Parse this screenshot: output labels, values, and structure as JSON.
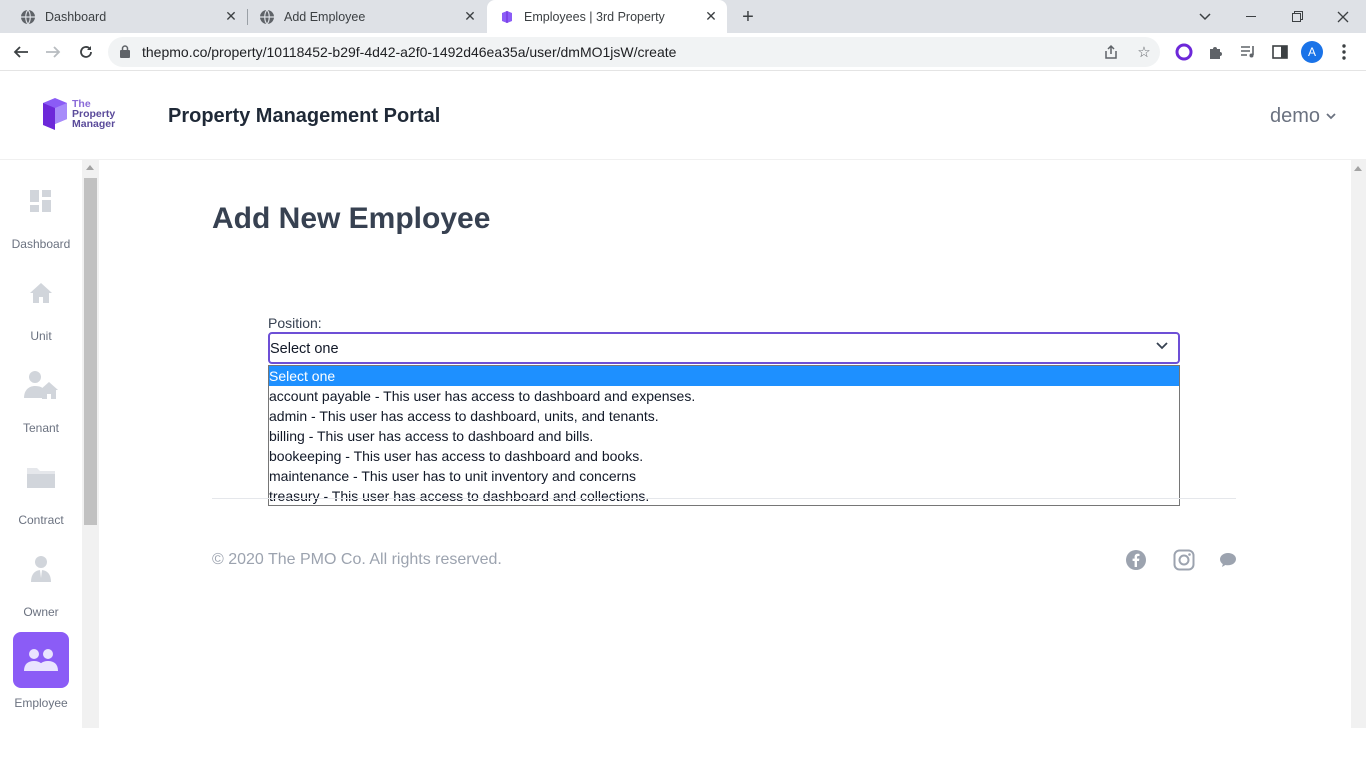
{
  "browser": {
    "tabs": [
      {
        "title": "Dashboard",
        "active": false
      },
      {
        "title": "Add Employee",
        "active": false
      },
      {
        "title": "Employees | 3rd Property",
        "active": true
      }
    ],
    "url": "thepmo.co/property/10118452-b29f-4d42-a2f0-1492d46ea35a/user/dmMO1jsW/create",
    "profile_initial": "A"
  },
  "header": {
    "logo_lines": [
      "The",
      "Property",
      "Manager"
    ],
    "title": "Property Management Portal",
    "user_label": "demo"
  },
  "sidebar": {
    "items": [
      {
        "label": "Dashboard",
        "icon": "dashboard-icon",
        "active": false
      },
      {
        "label": "Unit",
        "icon": "home-icon",
        "active": false
      },
      {
        "label": "Tenant",
        "icon": "tenant-icon",
        "active": false
      },
      {
        "label": "Contract",
        "icon": "folder-icon",
        "active": false
      },
      {
        "label": "Owner",
        "icon": "owner-icon",
        "active": false
      },
      {
        "label": "Employee",
        "icon": "employee-icon",
        "active": true
      }
    ]
  },
  "main": {
    "page_title": "Add New Employee",
    "position_label": "Position:",
    "position_value": "Select one",
    "position_options": [
      "Select one",
      "account payable - This user has access to dashboard and expenses.",
      "admin - This user has access to dashboard, units, and tenants.",
      "billing - This user has access to dashboard and bills.",
      "bookeeping - This user has access to dashboard and books.",
      "maintenance - This user has to unit inventory and concerns",
      "treasury - This user has access to dashboard and collections."
    ],
    "footer_copyright": "© 2020 The PMO Co. All rights reserved."
  },
  "colors": {
    "accent": "#8b5cf6",
    "select_border": "#6d4fd6",
    "option_highlight": "#1e90ff"
  }
}
